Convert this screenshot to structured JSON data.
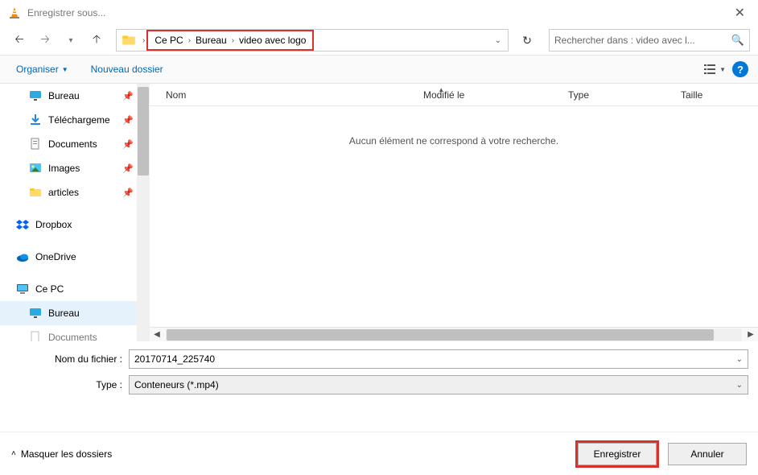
{
  "window": {
    "title": "Enregistrer sous..."
  },
  "breadcrumb": {
    "items": [
      "Ce PC",
      "Bureau",
      "video avec logo"
    ]
  },
  "search": {
    "placeholder": "Rechercher dans : video avec l..."
  },
  "toolbar": {
    "organize_label": "Organiser",
    "new_folder_label": "Nouveau dossier"
  },
  "columns": {
    "name": "Nom",
    "modified": "Modifié le",
    "type": "Type",
    "size": "Taille"
  },
  "content": {
    "empty_message": "Aucun élément ne correspond à votre recherche."
  },
  "sidebar": {
    "items": [
      {
        "label": "Bureau",
        "pinned": true,
        "kind": "desktop"
      },
      {
        "label": "Téléchargeme",
        "pinned": true,
        "kind": "download"
      },
      {
        "label": "Documents",
        "pinned": true,
        "kind": "documents"
      },
      {
        "label": "Images",
        "pinned": true,
        "kind": "images"
      },
      {
        "label": "articles",
        "pinned": true,
        "kind": "folder"
      }
    ],
    "groups": [
      {
        "label": "Dropbox",
        "kind": "dropbox"
      },
      {
        "label": "OneDrive",
        "kind": "onedrive"
      },
      {
        "label": "Ce PC",
        "kind": "pc"
      }
    ],
    "pc_children": [
      {
        "label": "Bureau",
        "selected": true,
        "kind": "desktop"
      },
      {
        "label": "Documents",
        "selected": false,
        "kind": "documents"
      }
    ]
  },
  "form": {
    "filename_label": "Nom du fichier :",
    "filename_value": "20170714_225740",
    "type_label": "Type :",
    "type_value": "Conteneurs (*.mp4)"
  },
  "footer": {
    "hide_folders_label": "Masquer les dossiers",
    "save_label": "Enregistrer",
    "cancel_label": "Annuler"
  }
}
